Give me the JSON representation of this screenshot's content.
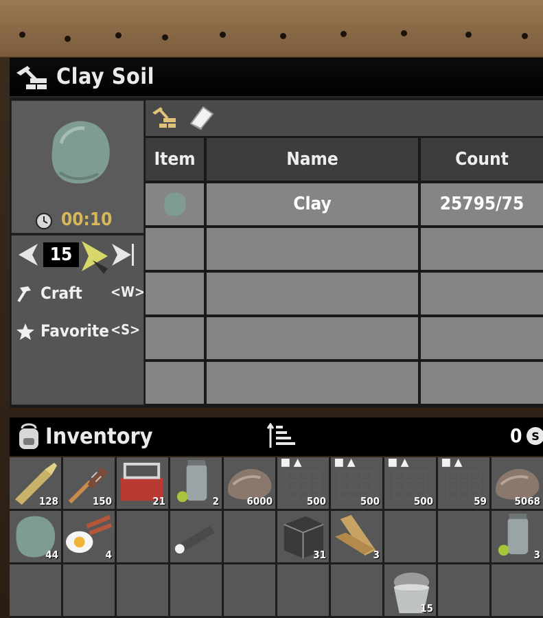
{
  "recipe": {
    "title": "Clay Soil",
    "craft_time": "00:10",
    "quantity": "15",
    "craft_label": "Craft",
    "craft_hotkey": "<W>",
    "favorite_label": "Favorite",
    "favorite_hotkey": "<S>"
  },
  "ingredients": {
    "headers": {
      "item": "Item",
      "name": "Name",
      "count": "Count"
    },
    "rows": [
      {
        "name": "Clay",
        "count": "25795/75"
      }
    ]
  },
  "inventory": {
    "title": "Inventory",
    "money": "0",
    "slots": [
      {
        "icon": "ammo-icon",
        "count": "128"
      },
      {
        "icon": "torch-icon",
        "count": "150"
      },
      {
        "icon": "toolbox-icon",
        "count": "21"
      },
      {
        "icon": "jar-icon",
        "count": "2"
      },
      {
        "icon": "rock-icon",
        "count": "6000"
      },
      {
        "icon": "rebar-frame-icon",
        "count": "500"
      },
      {
        "icon": "rebar-frame-icon",
        "count": "500"
      },
      {
        "icon": "rebar-frame-icon",
        "count": "500"
      },
      {
        "icon": "rebar-frame-icon",
        "count": "59"
      },
      {
        "icon": "rock-icon",
        "count": "5068"
      },
      {
        "icon": "clay-icon",
        "count": "44"
      },
      {
        "icon": "bacon-eggs-icon",
        "count": "4"
      },
      {
        "icon": "",
        "count": ""
      },
      {
        "icon": "flashlight-icon",
        "count": ""
      },
      {
        "icon": "",
        "count": ""
      },
      {
        "icon": "concrete-block-icon",
        "count": "31"
      },
      {
        "icon": "wood-planks-icon",
        "count": "3"
      },
      {
        "icon": "",
        "count": ""
      },
      {
        "icon": "",
        "count": ""
      },
      {
        "icon": "jar-icon",
        "count": "3"
      },
      {
        "icon": "",
        "count": ""
      },
      {
        "icon": "",
        "count": ""
      },
      {
        "icon": "",
        "count": ""
      },
      {
        "icon": "",
        "count": ""
      },
      {
        "icon": "",
        "count": ""
      },
      {
        "icon": "",
        "count": ""
      },
      {
        "icon": "",
        "count": ""
      },
      {
        "icon": "cement-bucket-icon",
        "count": "15"
      },
      {
        "icon": "",
        "count": ""
      },
      {
        "icon": "",
        "count": ""
      }
    ]
  }
}
